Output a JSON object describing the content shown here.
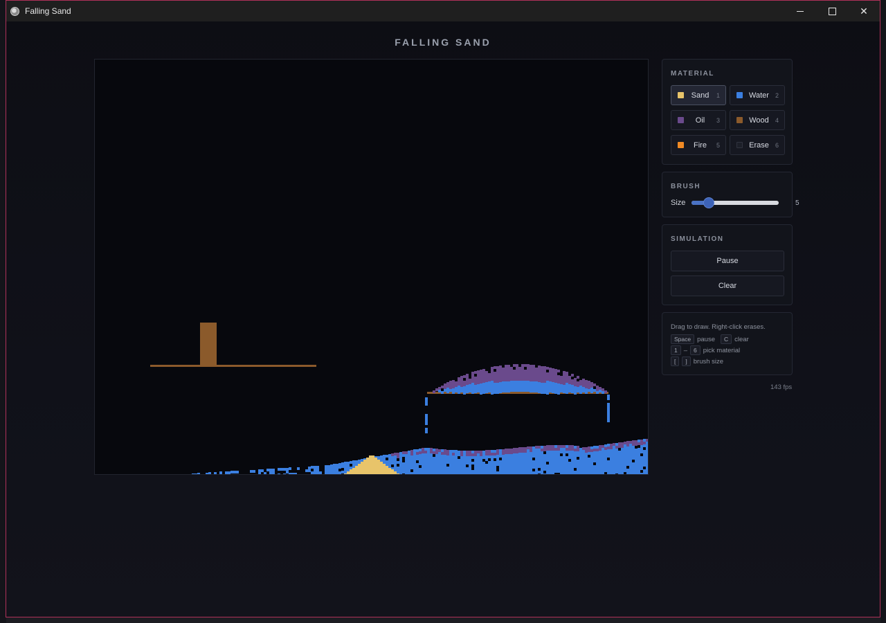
{
  "window": {
    "title": "Falling Sand",
    "controls": {
      "minimize": "minimize",
      "maximize": "maximize",
      "close": "✕"
    }
  },
  "app": {
    "heading": "FALLING SAND"
  },
  "material": {
    "title": "MATERIAL",
    "items": [
      {
        "label": "Sand",
        "key": "1",
        "color": "#e8c46a",
        "active": true
      },
      {
        "label": "Water",
        "key": "2",
        "color": "#3b7fe0",
        "active": false
      },
      {
        "label": "Oil",
        "key": "3",
        "color": "#6a4a8c",
        "active": false
      },
      {
        "label": "Wood",
        "key": "4",
        "color": "#8b5a2b",
        "active": false
      },
      {
        "label": "Fire",
        "key": "5",
        "color": "#f08a24",
        "active": false
      },
      {
        "label": "Erase",
        "key": "6",
        "color": "#1c1f28",
        "active": false
      }
    ]
  },
  "brush": {
    "title": "BRUSH",
    "size_label": "Size",
    "size_value": "5",
    "size_fraction": 0.2
  },
  "simulation": {
    "title": "SIMULATION",
    "pause_label": "Pause",
    "clear_label": "Clear"
  },
  "help": {
    "line1": "Drag to draw. Right-click erases.",
    "pause_key": "Space",
    "pause_text": "pause",
    "clear_key": "C",
    "clear_text": "clear",
    "pick_key_from": "1",
    "pick_dash": "–",
    "pick_key_to": "6",
    "pick_text": "pick material",
    "brush_key_a": "[",
    "brush_key_b": "]",
    "brush_text": "brush size"
  },
  "status": {
    "fps": "143 fps"
  },
  "colors": {
    "sand": "#e8c46a",
    "water": "#3b7fe0",
    "oil": "#6a4a8c",
    "wood": "#8b5a2b",
    "canvas_bg": "#07080d",
    "accent": "#4a72c4"
  }
}
